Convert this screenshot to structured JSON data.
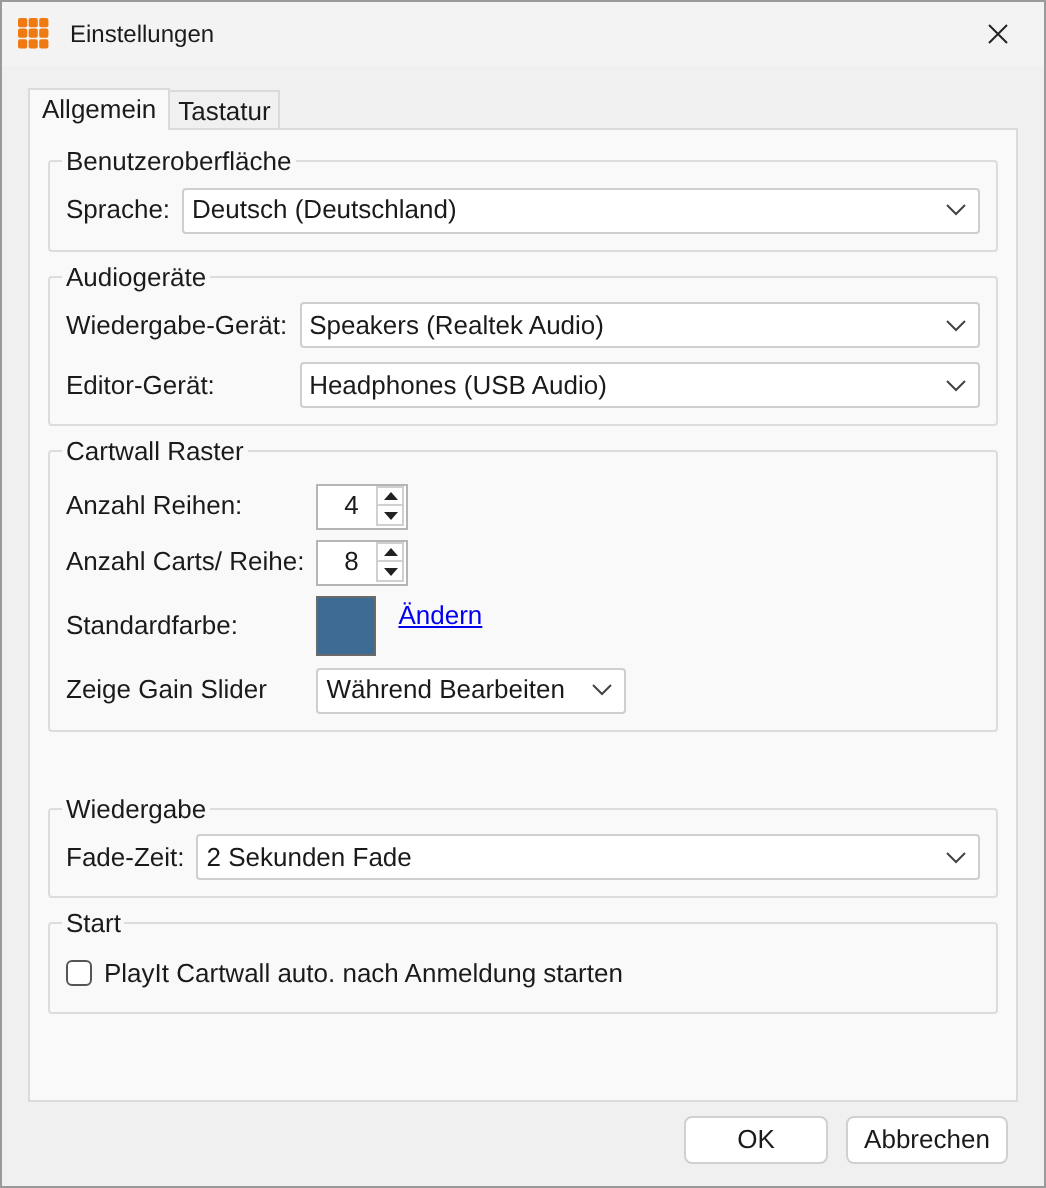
{
  "window": {
    "title": "Einstellungen"
  },
  "tabs": [
    {
      "label": "Allgemein",
      "selected": true
    },
    {
      "label": "Tastatur",
      "selected": false
    }
  ],
  "groups": [
    {
      "title": "Benutzeroberfläche",
      "rows": [
        {
          "kind": "select",
          "label": "Sprache:",
          "value": "Deutsch (Deutschland)"
        }
      ]
    },
    {
      "title": "Audiogeräte",
      "rows": [
        {
          "kind": "select",
          "label": "Wiedergabe-Gerät:",
          "value": "Speakers (Realtek Audio)"
        },
        {
          "kind": "select",
          "label": "Editor-Gerät:",
          "value": "Headphones (USB Audio)"
        }
      ]
    },
    {
      "title": "Cartwall Raster",
      "rows": [
        {
          "kind": "spinner",
          "label": "Anzahl Reihen:",
          "value": "4"
        },
        {
          "kind": "spinner",
          "label": "Anzahl Carts/ Reihe:",
          "value": "8"
        },
        {
          "kind": "color",
          "label": "Standardfarbe:",
          "color": "#3d6b94",
          "link": "Ändern"
        },
        {
          "kind": "compact_select",
          "label": "Zeige Gain Slider",
          "value": "Während Bearbeiten"
        }
      ]
    },
    {
      "title": "Wiedergabe",
      "rows": [
        {
          "kind": "select",
          "label": "Fade-Zeit:",
          "value": "2 Sekunden Fade"
        }
      ]
    },
    {
      "title": "Start",
      "rows": [
        {
          "kind": "checkbox",
          "label": "PlayIt Cartwall auto. nach Anmeldung starten",
          "checked": false
        }
      ]
    }
  ],
  "buttons": [
    "OK",
    "Abbrechen"
  ]
}
